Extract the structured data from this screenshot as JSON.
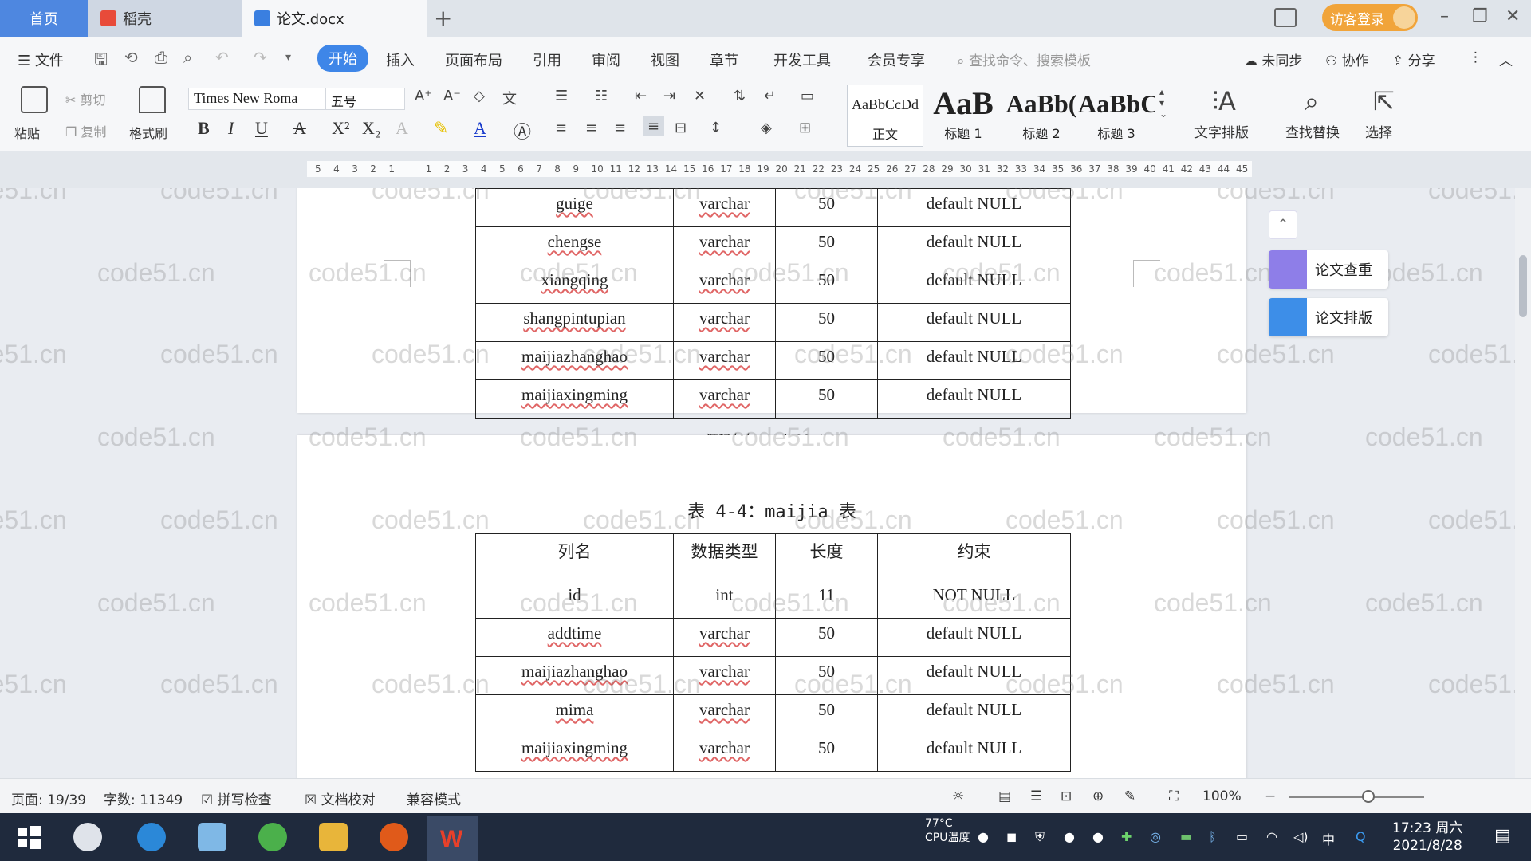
{
  "tabs": {
    "home": "首页",
    "daoke": "稻壳",
    "doc": "论文.docx",
    "new_tab": "+"
  },
  "titlebar": {
    "visitor_login": "访客登录"
  },
  "menu": {
    "file": "文件",
    "items": [
      "开始",
      "插入",
      "页面布局",
      "引用",
      "审阅",
      "视图",
      "章节",
      "开发工具",
      "会员专享"
    ],
    "active": "开始",
    "search_placeholder": "查找命令、搜索模板",
    "unsynced": "未同步",
    "collab": "协作",
    "share": "分享"
  },
  "ribbon": {
    "paste": "粘贴",
    "cut": "剪切",
    "copy": "复制",
    "format_painter": "格式刷",
    "font_name": "Times New Roma",
    "font_size": "五号",
    "styles": [
      {
        "sample": "AaBbCcDd",
        "name": "正文"
      },
      {
        "sample": "AaB",
        "name": "标题 1"
      },
      {
        "sample": "AaBb(",
        "name": "标题 2"
      },
      {
        "sample": "AaBbC",
        "name": "标题 3"
      }
    ],
    "text_layout": "文字排版",
    "find_replace": "查找替换",
    "select": "选择"
  },
  "ruler": {
    "ticks": [
      "5",
      "4",
      "3",
      "2",
      "1",
      "",
      "1",
      "2",
      "3",
      "4",
      "5",
      "6",
      "7",
      "8",
      "9",
      "10",
      "11",
      "12",
      "13",
      "14",
      "15",
      "16",
      "17",
      "18",
      "19",
      "20",
      "21",
      "22",
      "23",
      "24",
      "25",
      "26",
      "27",
      "28",
      "29",
      "30",
      "31",
      "32",
      "33",
      "34",
      "35",
      "36",
      "37",
      "38",
      "39",
      "40",
      "41",
      "42",
      "43",
      "44",
      "45"
    ]
  },
  "table_prev": {
    "rows": [
      [
        "guige",
        "varchar",
        "50",
        "default NULL"
      ],
      [
        "chengse",
        "varchar",
        "50",
        "default NULL"
      ],
      [
        "xiangqing",
        "varchar",
        "50",
        "default NULL"
      ],
      [
        "shangpintupian",
        "varchar",
        "50",
        "default NULL"
      ],
      [
        "maijiazhanghao",
        "varchar",
        "50",
        "default NULL"
      ],
      [
        "maijiaxingming",
        "varchar",
        "50",
        "default NULL"
      ]
    ]
  },
  "source_note": "源码久久-code99.top",
  "table_maijia": {
    "caption": "表 4-4：maijia 表",
    "headers": [
      "列名",
      "数据类型",
      "长度",
      "约束"
    ],
    "rows": [
      [
        "id",
        "int",
        "11",
        "NOT NULL"
      ],
      [
        "addtime",
        "varchar",
        "50",
        "default NULL"
      ],
      [
        "maijiazhanghao",
        "varchar",
        "50",
        "default NULL"
      ],
      [
        "mima",
        "varchar",
        "50",
        "default NULL"
      ],
      [
        "maijiaxingming",
        "varchar",
        "50",
        "default NULL"
      ]
    ]
  },
  "watermark": "code51.cn",
  "side_panel": {
    "paper_check": "论文查重",
    "paper_format": "论文排版"
  },
  "status": {
    "page": "页面: 19/39",
    "words": "字数: 11349",
    "spell_check": "拼写检查",
    "doc_proof": "文档校对",
    "compat_mode": "兼容模式",
    "zoom": "100%"
  },
  "taskbar": {
    "temp": "77°C",
    "cpu": "CPU温度",
    "ime": "中",
    "time": "17:23 周六",
    "date": "2021/8/28"
  }
}
